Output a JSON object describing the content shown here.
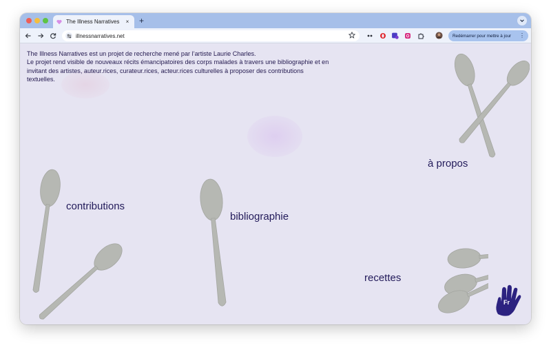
{
  "browser": {
    "tab_title": "The Illness Narratives",
    "tab_close": "×",
    "new_tab": "+",
    "url": "illnessnarratives.net",
    "update_button": "Redémarrer pour mettre à jour",
    "update_menu": "⋮"
  },
  "page": {
    "intro_line1": "The Illness Narratives est un projet de recherche mené par l’artiste Laurie Charles.",
    "intro_line2": "Le projet rend visible de nouveaux récits émancipatoires des corps malades à travers une bibliographie et en invitant des artistes, auteur.rices, curateur.rices, acteur.rices culturelles à proposer des contributions textuelles.",
    "nav": {
      "contributions": "contributions",
      "bibliographie": "bibliographie",
      "a_propos": "à propos",
      "recettes": "recettes"
    },
    "language": "Fr"
  },
  "colors": {
    "tab_bar": "#a6bfe9",
    "page_background": "#e6e4f2",
    "text": "#221a5a",
    "hand": "#2c2280",
    "spoon": "#b6b8b3"
  },
  "icons": [
    "back-arrow-icon",
    "forward-arrow-icon",
    "reload-icon",
    "site-info-icon",
    "bookmark-star-icon",
    "hand-icon"
  ]
}
